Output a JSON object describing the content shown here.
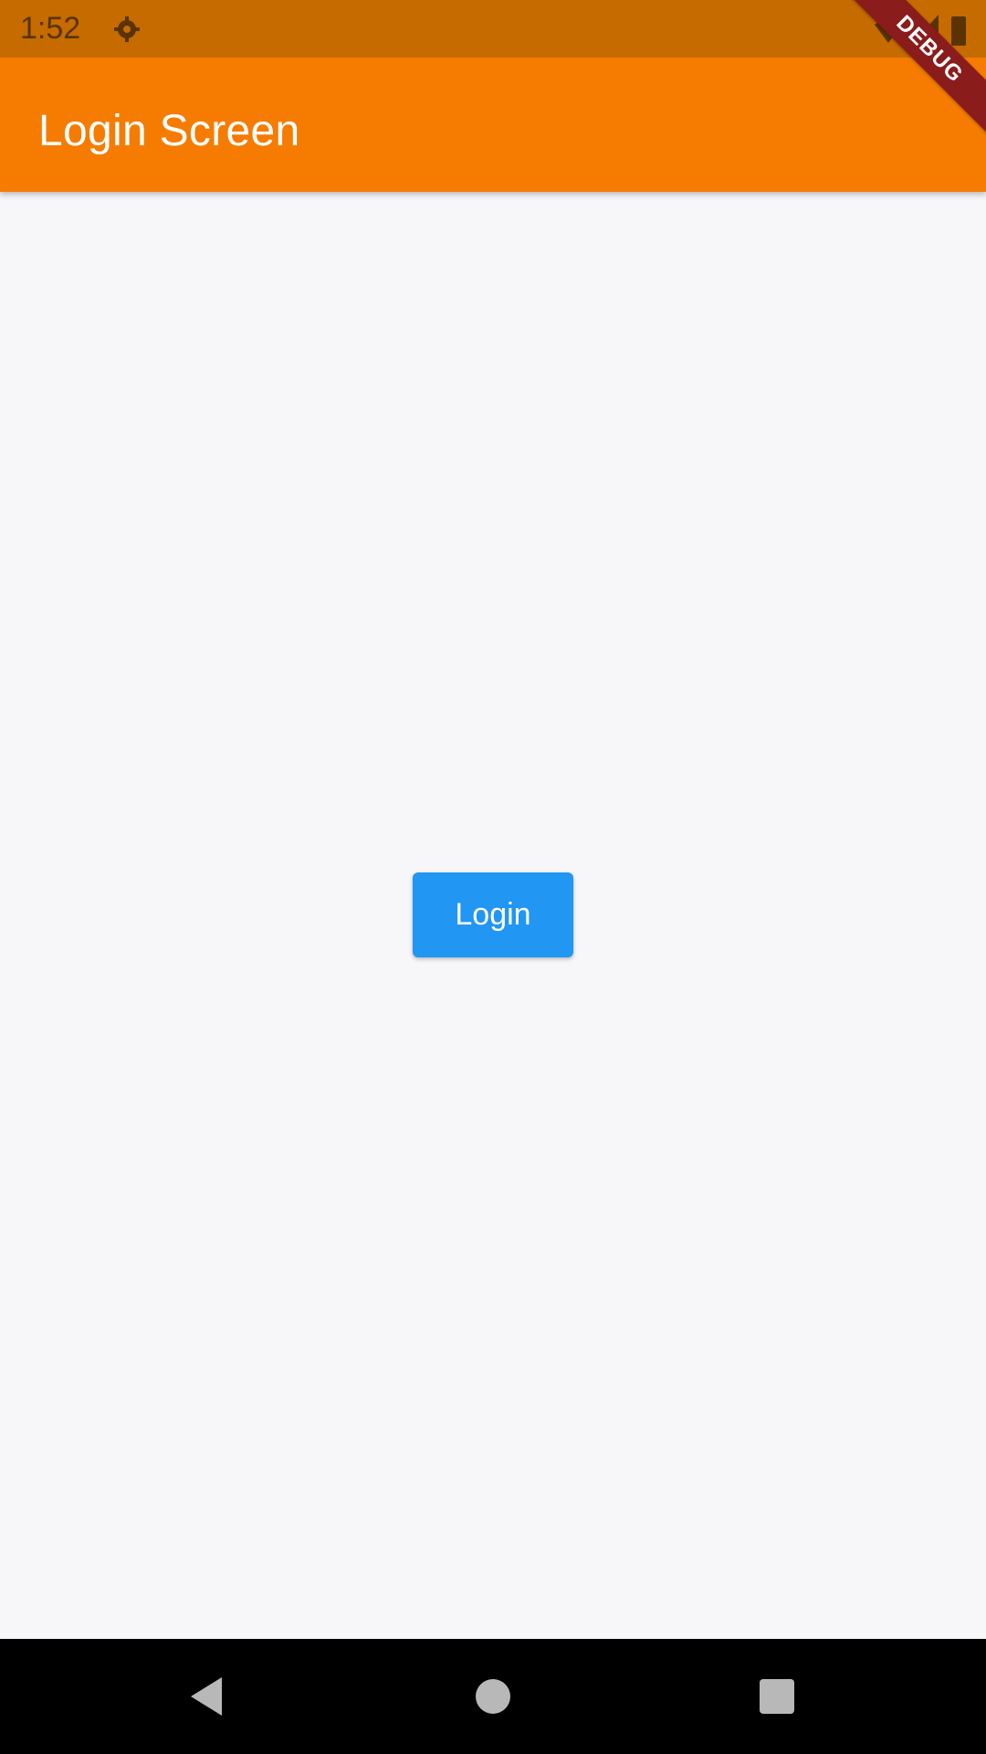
{
  "status_bar": {
    "time": "1:52",
    "icons": [
      "settings-gear-icon",
      "wifi-icon",
      "signal-icon",
      "battery-icon"
    ]
  },
  "app_bar": {
    "title": "Login Screen",
    "color": "#f57c00"
  },
  "debug_banner": {
    "label": "DEBUG"
  },
  "main": {
    "login_button_label": "Login",
    "button_color": "#2196f3"
  },
  "nav_bar": {
    "icons": [
      "back-triangle-icon",
      "home-circle-icon",
      "recents-square-icon"
    ]
  }
}
